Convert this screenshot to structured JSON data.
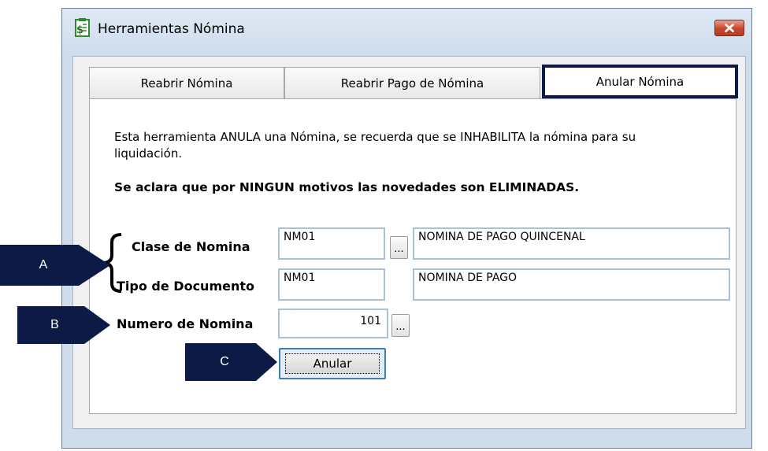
{
  "window": {
    "title": "Herramientas Nómina",
    "close_glyph": "✕",
    "app_icon": "payroll-dollar-document-icon"
  },
  "tabs": [
    {
      "label": "Reabrir Nómina",
      "active": false
    },
    {
      "label": "Reabrir Pago de Nómina",
      "active": false
    },
    {
      "label": "Anular Nómina",
      "active": true
    }
  ],
  "panel": {
    "description": "Esta herramienta ANULA una Nómina, se recuerda que se INHABILITA la nómina para su liquidación.",
    "warning": "Se aclara que por NINGUN motivos las novedades son ELIMINADAS."
  },
  "form": {
    "clase": {
      "label": "Clase de Nomina",
      "code": "NM01",
      "description": "NOMINA DE PAGO QUINCENAL",
      "lookup_label": "..."
    },
    "tipo": {
      "label": "Tipo de Documento",
      "code": "NM01",
      "description": "NOMINA DE PAGO"
    },
    "numero": {
      "label": "Numero de Nomina",
      "value": "101",
      "lookup_label": "..."
    },
    "submit_label": "Anular"
  },
  "callouts": {
    "a": "A",
    "b": "B",
    "c": "C"
  },
  "colors": {
    "callout": "#0c1a45",
    "active_tab_border": "#0c1a45",
    "close_button": "#c8452b"
  }
}
